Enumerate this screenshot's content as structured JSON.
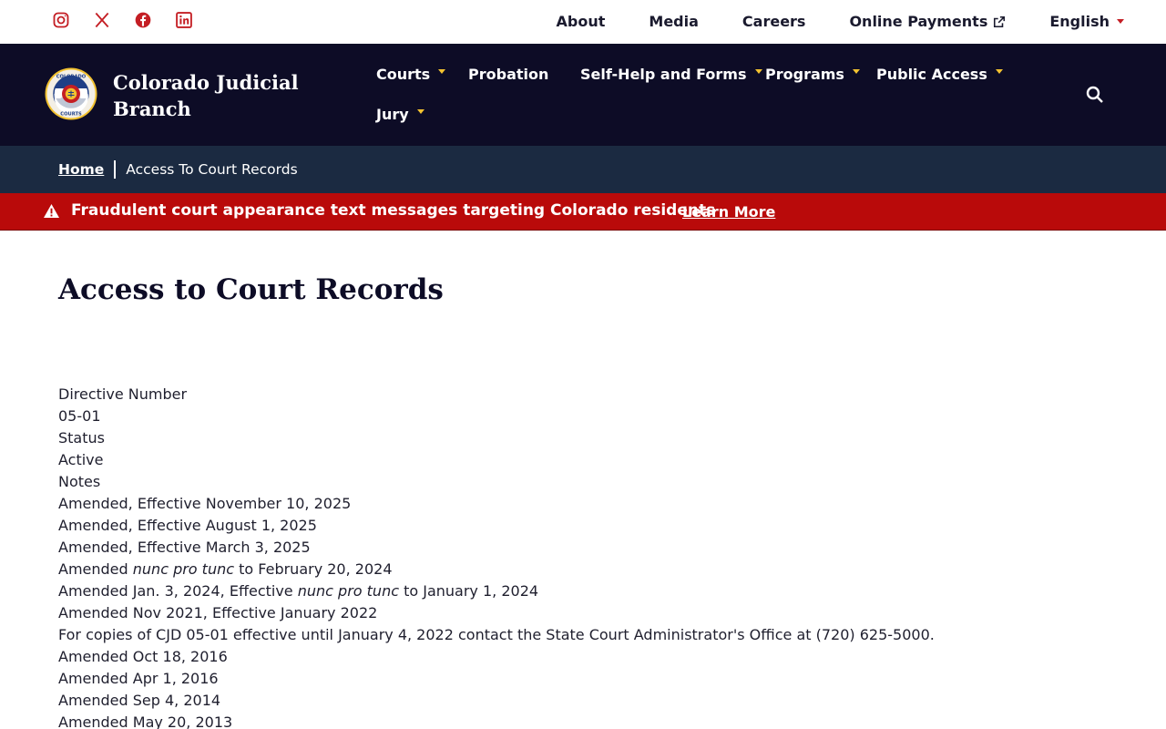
{
  "social": [
    {
      "name": "instagram-icon"
    },
    {
      "name": "x-icon"
    },
    {
      "name": "facebook-icon"
    },
    {
      "name": "linkedin-icon"
    }
  ],
  "utility_nav": {
    "about": "About",
    "media": "Media",
    "careers": "Careers",
    "online_payments": "Online Payments",
    "language": "English"
  },
  "brand": {
    "line1": "Colorado Judicial",
    "line2": "Branch",
    "logo_text_top": "COLORADO",
    "logo_text_bottom": "COURTS"
  },
  "main_nav": {
    "courts": "Courts",
    "probation": "Probation",
    "self_help": "Self-Help and Forms",
    "programs": "Programs",
    "public_access": "Public Access",
    "jury": "Jury"
  },
  "breadcrumb": {
    "home": "Home",
    "current": "Access To Court Records"
  },
  "alert": {
    "text": "Fraudulent court appearance text messages targeting Colorado residents",
    "link": "Learn More"
  },
  "page_title": "Access to Court Records",
  "details": {
    "directive_label": "Directive Number",
    "directive_value": "05-01",
    "status_label": "Status",
    "status_value": "Active",
    "notes_label": "Notes",
    "notes": [
      {
        "pre": "Amended, Effective November 10, 2025",
        "em": "",
        "post": ""
      },
      {
        "pre": "Amended, Effective August 1, 2025",
        "em": "",
        "post": ""
      },
      {
        "pre": "Amended, Effective March 3, 2025",
        "em": "",
        "post": ""
      },
      {
        "pre": "Amended ",
        "em": "nunc pro tunc",
        "post": " to February 20, 2024"
      },
      {
        "pre": "Amended Jan. 3, 2024, Effective ",
        "em": "nunc pro tunc",
        "post": " to January 1, 2024"
      },
      {
        "pre": "Amended Nov 2021, Effective January 2022",
        "em": "",
        "post": ""
      },
      {
        "pre": "For copies of CJD 05-01 effective until January 4, 2022 contact the State Court Administrator's Office at (720) 625-5000.",
        "em": "",
        "post": ""
      },
      {
        "pre": "Amended Oct 18, 2016",
        "em": "",
        "post": ""
      },
      {
        "pre": "Amended Apr 1, 2016",
        "em": "",
        "post": ""
      },
      {
        "pre": "Amended Sep 4, 2014",
        "em": "",
        "post": ""
      },
      {
        "pre": "Amended May 20, 2013",
        "em": "",
        "post": ""
      }
    ]
  },
  "colors": {
    "navy": "#0d0c26",
    "breadcrumb_bg": "#1b2a41",
    "alert_red": "#b90a0a",
    "accent_red": "#c41e24",
    "accent_gold": "#f2c230"
  }
}
